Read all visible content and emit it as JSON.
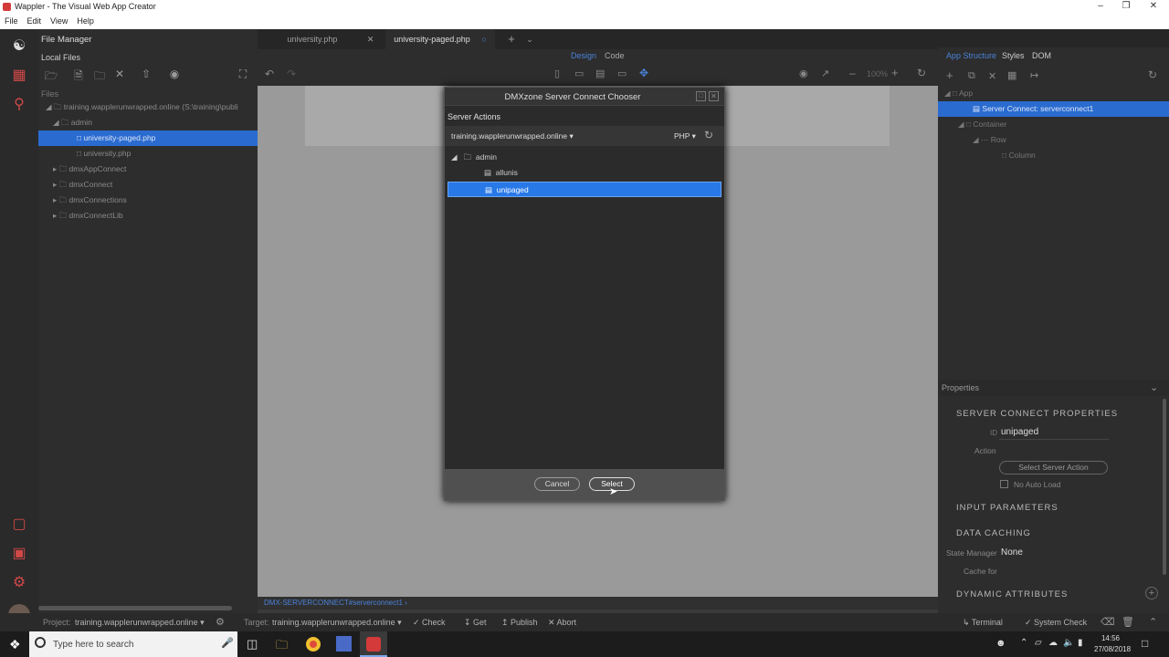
{
  "window": {
    "title": "Wappler - The Visual Web App Creator"
  },
  "menu": [
    "File",
    "Edit",
    "View",
    "Help"
  ],
  "file_manager": {
    "title": "File Manager",
    "local_files": "Local Files",
    "files_label": "Files",
    "tree": [
      {
        "label": "training.wapplerunwrapped.online (S:\\training\\publi"
      },
      {
        "label": "admin"
      },
      {
        "label": "university-paged.php"
      },
      {
        "label": "university.php"
      },
      {
        "label": "dmxAppConnect"
      },
      {
        "label": "dmxConnect"
      },
      {
        "label": "dmxConnections"
      },
      {
        "label": "dmxConnectLib"
      }
    ]
  },
  "editor": {
    "tabs": [
      {
        "label": "university.php"
      },
      {
        "label": "university-paged.php"
      }
    ],
    "views": {
      "design": "Design",
      "code": "Code"
    },
    "zoom": "100%",
    "status_path": "DMX-SERVERCONNECT#serverconnect1 ›"
  },
  "dialog": {
    "title": "DMXzone Server Connect Chooser",
    "section": "Server Actions",
    "site": "training.wapplerunwrapped.online ▾",
    "lang": "PHP ▾",
    "tree": [
      {
        "label": "admin"
      },
      {
        "label": "allunis"
      },
      {
        "label": "unipaged"
      }
    ],
    "cancel": "Cancel",
    "select": "Select"
  },
  "right_panel": {
    "tabs": {
      "app_structure": "App Structure",
      "styles": "Styles",
      "dom": "DOM"
    },
    "tree": [
      {
        "label": "App"
      },
      {
        "label": "Server Connect: serverconnect1"
      },
      {
        "label": "Container"
      },
      {
        "label": "Row"
      },
      {
        "label": "Column"
      }
    ],
    "properties": {
      "title": "Properties",
      "server_connect_heading": "SERVER CONNECT PROPERTIES",
      "id_label": "ID",
      "id_value": "unipaged",
      "action_label": "Action",
      "select_action_button": "Select Server Action",
      "no_auto_load": "No Auto Load",
      "input_params": "INPUT PARAMETERS",
      "data_caching": "DATA CACHING",
      "state_manager_label": "State Manager",
      "state_manager_value": "None",
      "cache_for_label": "Cache for",
      "dynamic_attributes": "DYNAMIC ATTRIBUTES"
    }
  },
  "bottom_bar": {
    "project_label": "Project:",
    "project_value": "training.wapplerunwrapped.online ▾",
    "target_label": "Target:",
    "target_value": "training.wapplerunwrapped.online ▾",
    "check": "Check",
    "get": "Get",
    "publish": "Publish",
    "abort": "Abort",
    "terminal": "Terminal",
    "system_check": "System Check"
  },
  "taskbar": {
    "search_placeholder": "Type here to search",
    "time": "14:56",
    "date": "27/08/2018"
  }
}
